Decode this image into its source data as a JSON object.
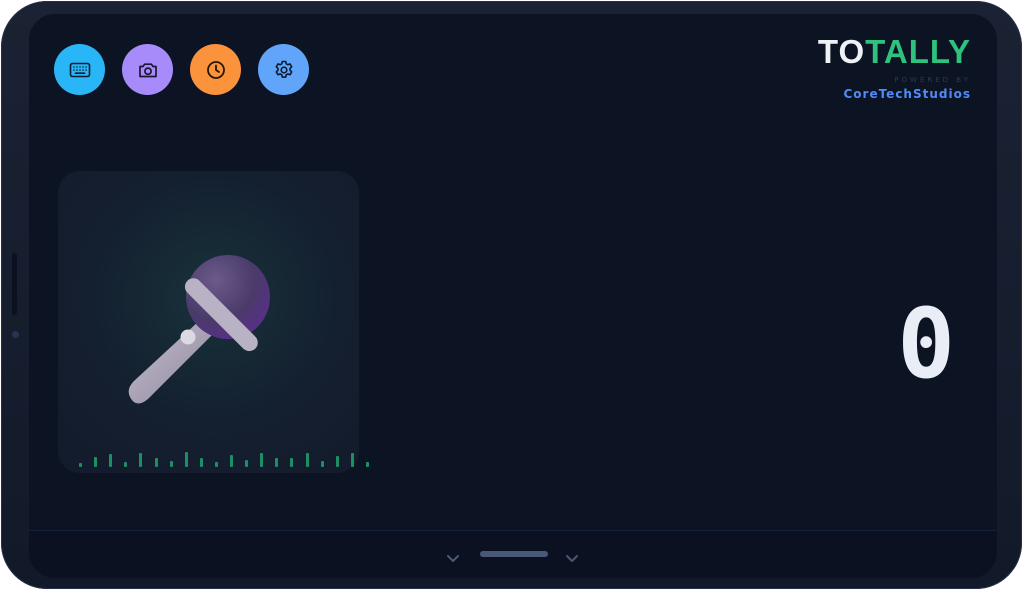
{
  "app": {
    "brand_to": "TO",
    "brand_tally": "TALLY",
    "powered_by": "POWERED BY",
    "company": "CoreTechStudios"
  },
  "toolbar": {
    "buttons": [
      {
        "icon": "keyboard-icon",
        "color": "#29b6f6"
      },
      {
        "icon": "camera-icon",
        "color": "#a78bfa"
      },
      {
        "icon": "clock-icon",
        "color": "#fb923c"
      },
      {
        "icon": "gear-icon",
        "color": "#60a5fa"
      }
    ]
  },
  "mic": {
    "icon": "microphone-icon",
    "waveform_levels": [
      0.25,
      0.6,
      0.75,
      0.3,
      0.85,
      0.55,
      0.35,
      0.9,
      0.5,
      0.3,
      0.7,
      0.4,
      0.85,
      0.55,
      0.5,
      0.8,
      0.35,
      0.65,
      0.85,
      0.3
    ]
  },
  "counter": {
    "value": "0"
  },
  "colors": {
    "accent_green": "#2ec27e",
    "accent_blue": "#4f8cf7",
    "screen_bg": "#0c1322"
  },
  "bottom": {
    "left_icon": "chevron-down-icon",
    "right_icon": "chevron-down-icon"
  }
}
